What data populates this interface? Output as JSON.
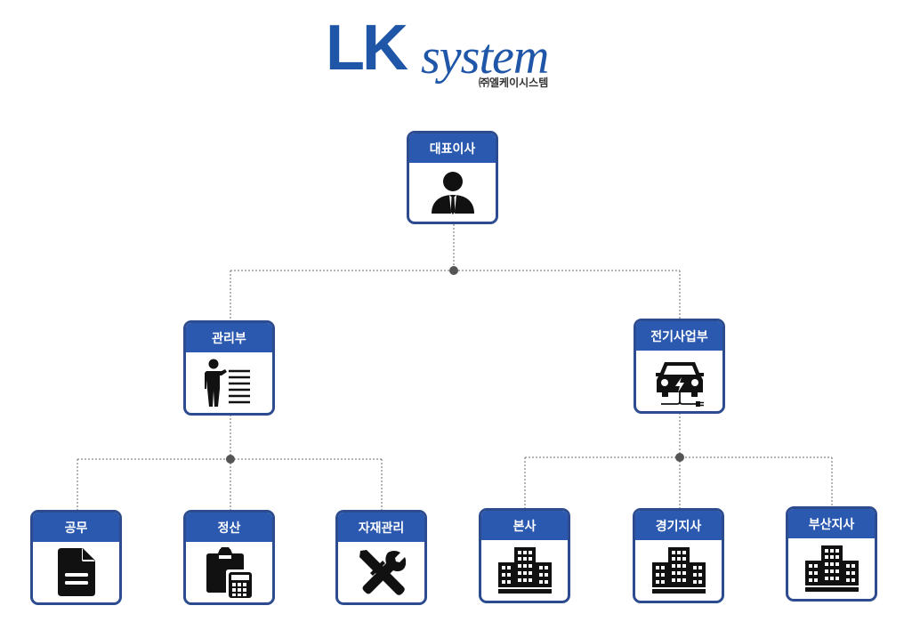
{
  "logo": {
    "brand_main": "LK",
    "brand_system": "system",
    "subtitle": "㈜엘케이시스템"
  },
  "colors": {
    "header_blue": "#2b59b0",
    "border_navy": "#2d4c8f",
    "brand_blue": "#1f56a8",
    "connector_gray": "#9a9a9a"
  },
  "org": {
    "ceo": {
      "label": "대표이사",
      "icon": "person-icon"
    },
    "management": {
      "label": "관리부",
      "icon": "presenter-list-icon",
      "children": [
        {
          "label": "공무",
          "icon": "document-icon"
        },
        {
          "label": "정산",
          "icon": "clipboard-calculator-icon"
        },
        {
          "label": "자재관리",
          "icon": "tools-icon"
        }
      ]
    },
    "ev_business": {
      "label": "전기사업부",
      "icon": "electric-car-icon",
      "children": [
        {
          "label": "본사",
          "icon": "building-icon"
        },
        {
          "label": "경기지사",
          "icon": "building-icon"
        },
        {
          "label": "부산지사",
          "icon": "building-icon"
        }
      ]
    }
  }
}
